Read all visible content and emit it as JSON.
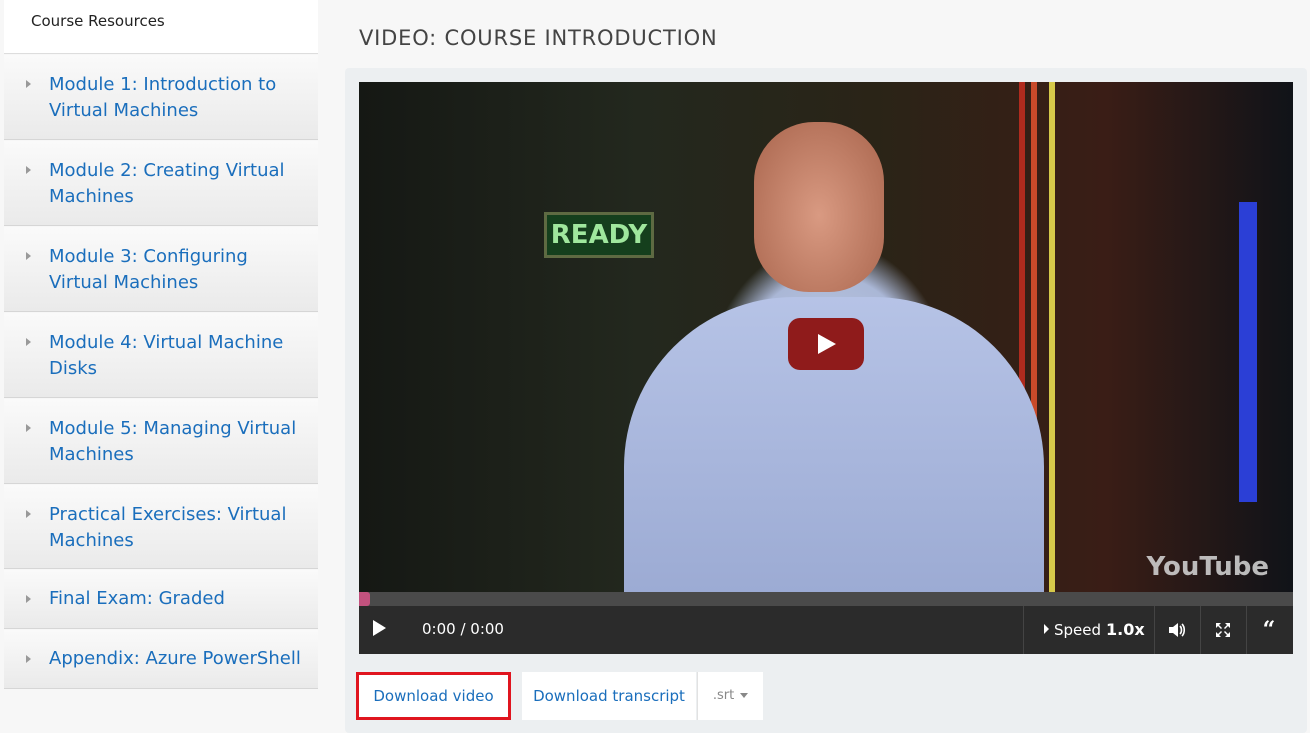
{
  "sidebar": {
    "header": "Course Resources",
    "items": [
      {
        "label": "Module 1: Introduction to Virtual Machines"
      },
      {
        "label": "Module 2: Creating Virtual Machines"
      },
      {
        "label": "Module 3: Configuring Virtual Machines"
      },
      {
        "label": "Module 4: Virtual Machine Disks"
      },
      {
        "label": "Module 5: Managing Virtual Machines"
      },
      {
        "label": "Practical Exercises: Virtual Machines"
      },
      {
        "label": "Final Exam: Graded"
      },
      {
        "label": "Appendix: Azure PowerShell"
      }
    ]
  },
  "main": {
    "title": "VIDEO: COURSE INTRODUCTION",
    "video": {
      "sign_text": "READY",
      "watermark": "YouTube",
      "progress": 0,
      "time": "0:00 / 0:00",
      "speed_label": "Speed",
      "speed_value": "1.0x",
      "icons": [
        "play-icon",
        "volume-icon",
        "fullscreen-icon",
        "captions-icon"
      ]
    },
    "buttons": {
      "download_video": "Download video",
      "download_transcript": "Download transcript",
      "transcript_format": ".srt"
    }
  },
  "colors": {
    "link": "#1a6ebc",
    "highlight_border": "#e0151f",
    "progress_knob": "#c2527e",
    "play_button": "#8f1b1b"
  }
}
